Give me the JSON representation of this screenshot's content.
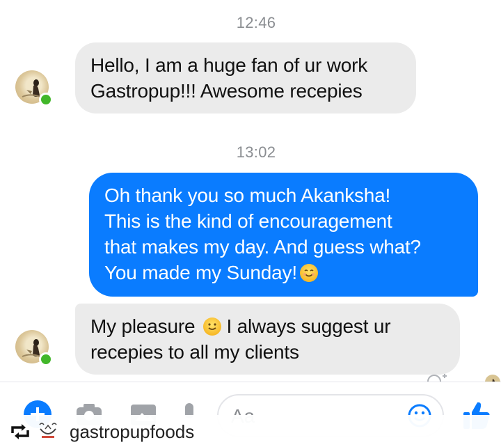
{
  "thread": {
    "messages": [
      {
        "timestamp": "12:46",
        "sender": "other",
        "lines": [
          "Hello, I am a huge fan of ur work",
          "Gastropup!!! Awesome recepies"
        ]
      },
      {
        "timestamp": "13:02",
        "sender": "me",
        "lines": [
          "Oh thank you so much Akanksha!",
          "This is the kind of encouragement",
          "that makes my day. And guess what?",
          "You made my Sunday!"
        ],
        "emoji": "smiling-face"
      },
      {
        "sender": "other",
        "lines": [
          "My pleasure",
          "I always suggest ur",
          "recepies to all my clients"
        ],
        "emoji": "smiling-face"
      }
    ]
  },
  "composer": {
    "placeholder": "Aa",
    "icons": [
      "plus-icon",
      "camera-icon",
      "gallery-icon",
      "emoji-icon",
      "thumbs-up-icon"
    ]
  },
  "repost_footer": {
    "account": "gastropupfoods",
    "icons": [
      "repost-icon",
      "brand-logo"
    ]
  },
  "colors": {
    "outgoing_bubble": "#0a7cff",
    "incoming_bubble": "#ebebeb",
    "accent": "#0a7cff",
    "online_dot": "#42b72a"
  }
}
